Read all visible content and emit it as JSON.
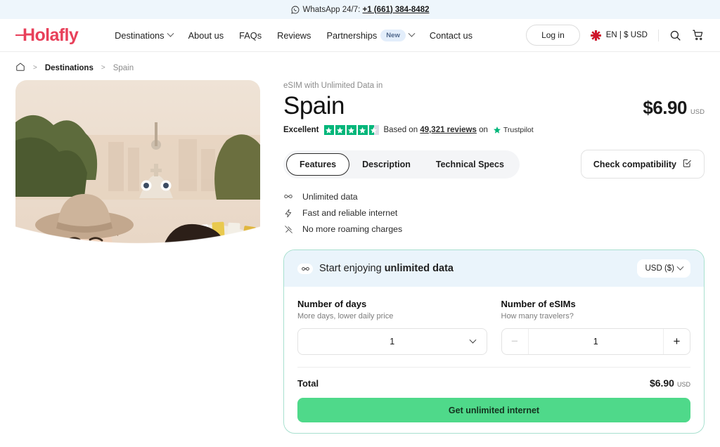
{
  "topbar": {
    "icon": "whatsapp-icon",
    "text": "WhatsApp 24/7:",
    "phone": "+1 (661) 384-8482"
  },
  "header": {
    "logo": "Holafly",
    "nav": [
      {
        "label": "Destinations",
        "has_chevron": true
      },
      {
        "label": "About us",
        "has_chevron": false
      },
      {
        "label": "FAQs",
        "has_chevron": false
      },
      {
        "label": "Reviews",
        "has_chevron": false
      },
      {
        "label": "Partnerships",
        "has_chevron": true,
        "badge": "New"
      },
      {
        "label": "Contact us",
        "has_chevron": false
      }
    ],
    "login_label": "Log in",
    "locale": "EN | $ USD",
    "flag_icon": "uk-flag-icon",
    "search_icon": "search-icon",
    "cart_icon": "cart-icon"
  },
  "breadcrumb": {
    "home_icon": "home-icon",
    "separator": ">",
    "items": [
      {
        "label": "Destinations"
      },
      {
        "label": "Spain"
      }
    ]
  },
  "hero": {
    "alt": "Two women taking a selfie at Park Guell in Barcelona, Spain"
  },
  "product": {
    "eyebrow": "eSIM with Unlimited Data in",
    "title": "Spain",
    "price": "$6.90",
    "price_currency": "USD"
  },
  "rating": {
    "word": "Excellent",
    "stars": 4.5,
    "star_color": "#00b67a",
    "prefix": "Based on",
    "reviews": "49,321 reviews",
    "middle": "on",
    "provider": "Trustpilot"
  },
  "tabs": [
    {
      "label": "Features",
      "active": true
    },
    {
      "label": "Description",
      "active": false
    },
    {
      "label": "Technical Specs",
      "active": false
    }
  ],
  "compatibility": {
    "label": "Check compatibility",
    "icon": "checklist-document-icon"
  },
  "features": [
    {
      "icon": "infinity-icon",
      "label": "Unlimited data"
    },
    {
      "icon": "lightning-bolt-icon",
      "label": "Fast and reliable internet"
    },
    {
      "icon": "no-roaming-icon",
      "label": "No more roaming charges"
    }
  ],
  "buy": {
    "head_icon": "infinity-icon",
    "head_prefix": "Start enjoying ",
    "head_strong": "unlimited data",
    "currency_select": "USD ($)",
    "days": {
      "label": "Number of days",
      "sublabel": "More days, lower daily price",
      "value": "1"
    },
    "esims": {
      "label": "Number of eSIMs",
      "sublabel": "How many travelers?",
      "value": "1",
      "minus": "−",
      "plus": "+"
    },
    "total_label": "Total",
    "total_price": "$6.90",
    "total_currency": "USD",
    "cta_label": "Get unlimited internet"
  },
  "colors": {
    "brand": "#e8405a",
    "cta_green": "#4fd98a",
    "trustpilot_green": "#00b67a",
    "card_border": "#a8e0cf",
    "card_header_bg": "#eaf4fb",
    "topbar_bg": "#eef6fc"
  }
}
